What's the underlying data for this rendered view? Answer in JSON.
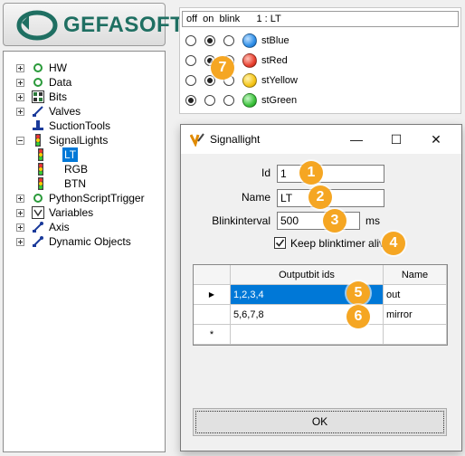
{
  "logo": {
    "text": "GEFASOFT"
  },
  "tree": {
    "items": [
      {
        "label": "HW",
        "expander": "plus",
        "icon": "green-swirl-icon"
      },
      {
        "label": "Data",
        "expander": "plus",
        "icon": "green-swirl-icon"
      },
      {
        "label": "Bits",
        "expander": "plus",
        "icon": "bits-grid-icon"
      },
      {
        "label": "Valves",
        "expander": "plus",
        "icon": "valve-icon"
      },
      {
        "label": "SuctionTools",
        "expander": "none",
        "icon": "suction-icon"
      },
      {
        "label": "SignalLights",
        "expander": "minus",
        "icon": "signal-light-icon"
      },
      {
        "label": "LT",
        "expander": "none",
        "icon": "signal-light-icon",
        "selected": true
      },
      {
        "label": "RGB",
        "expander": "none",
        "icon": "signal-light-icon"
      },
      {
        "label": "BTN",
        "expander": "none",
        "icon": "signal-light-icon"
      },
      {
        "label": "PythonScriptTrigger",
        "expander": "plus",
        "icon": "green-swirl-icon"
      },
      {
        "label": "Variables",
        "expander": "plus",
        "icon": "variables-icon"
      },
      {
        "label": "Axis",
        "expander": "plus",
        "icon": "axis-icon"
      },
      {
        "label": "Dynamic Objects",
        "expander": "plus",
        "icon": "axis-icon"
      }
    ]
  },
  "signal_panel": {
    "header": "off  on  blink      1 : LT",
    "rows": [
      {
        "label": "stBlue",
        "selected": "on",
        "color": "#2f8fe8"
      },
      {
        "label": "stRed",
        "selected": "on",
        "color": "#e8402f"
      },
      {
        "label": "stYellow",
        "selected": "off",
        "color": "#f5c518"
      },
      {
        "label": "stGreen",
        "selected": "off",
        "color": "#3cc23c"
      }
    ]
  },
  "dialog": {
    "title": "Signallight",
    "minimize": "—",
    "maximize": "☐",
    "close": "✕",
    "id_label": "Id",
    "id_value": "1",
    "name_label": "Name",
    "name_value": "LT",
    "blink_label": "Blinkinterval",
    "blink_value": "500",
    "blink_unit": "ms",
    "keep_label": "Keep blinktimer alive",
    "keep_checked": true,
    "grid": {
      "headers": [
        "Outputbit ids",
        "Name"
      ],
      "rows": [
        {
          "outputbits": "1,2,3,4",
          "name": "out"
        },
        {
          "outputbits": "5,6,7,8",
          "name": "mirror"
        }
      ],
      "current_row_marker": "▶",
      "new_row_marker": "*"
    },
    "ok_label": "OK"
  },
  "badges": [
    "1",
    "2",
    "3",
    "4",
    "5",
    "6",
    "7"
  ],
  "colors": {
    "accent": "#0078d7",
    "badge": "#f5a623",
    "logo": "#1f6f62"
  }
}
